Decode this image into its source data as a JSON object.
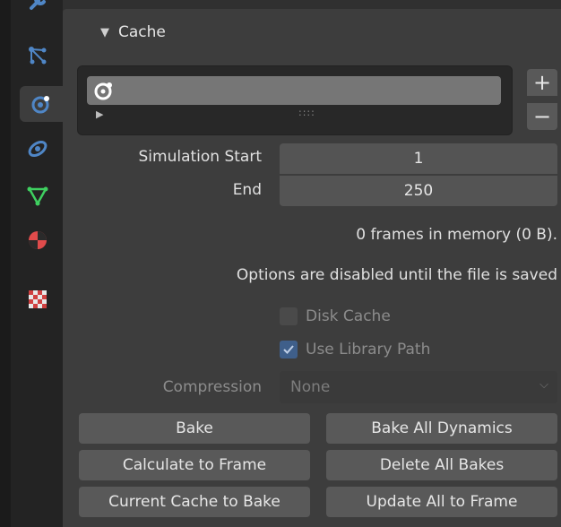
{
  "panel": {
    "title": "Cache",
    "collapse_glyph": "▼"
  },
  "cache_list": {
    "expander_glyph": "▶",
    "grip_glyph": "::::",
    "add_label": "+",
    "remove_label": "−"
  },
  "fields": {
    "sim_start_label": "Simulation Start",
    "sim_start_value": "1",
    "end_label": "End",
    "end_value": "250"
  },
  "info": {
    "frames_in_memory": "0 frames in memory (0 B).",
    "disabled_note": "Options are disabled until the file is saved"
  },
  "options": {
    "disk_cache_label": "Disk Cache",
    "disk_cache_checked": false,
    "library_path_label": "Use Library Path",
    "library_path_checked": true,
    "compression_label": "Compression",
    "compression_value": "None",
    "compression_chevron": "⌵"
  },
  "buttons": {
    "bake": "Bake",
    "bake_all": "Bake All Dynamics",
    "calc_to_frame": "Calculate to Frame",
    "delete_all": "Delete All Bakes",
    "current_to_bake": "Current Cache to Bake",
    "update_all": "Update All to Frame"
  },
  "colors": {
    "accent_blue": "#4f86c6",
    "constraint_green": "#3fcf9f",
    "mesh_green": "#3fd060",
    "material_red": "#e04b4b"
  },
  "tabs": [
    {
      "icon": "wrench-icon"
    },
    {
      "icon": "particles-icon"
    },
    {
      "icon": "physics-icon",
      "active": true
    },
    {
      "icon": "constraints-icon"
    },
    {
      "icon": "mesh-data-icon"
    },
    {
      "icon": "material-icon"
    },
    {
      "icon": "texture-icon"
    }
  ]
}
